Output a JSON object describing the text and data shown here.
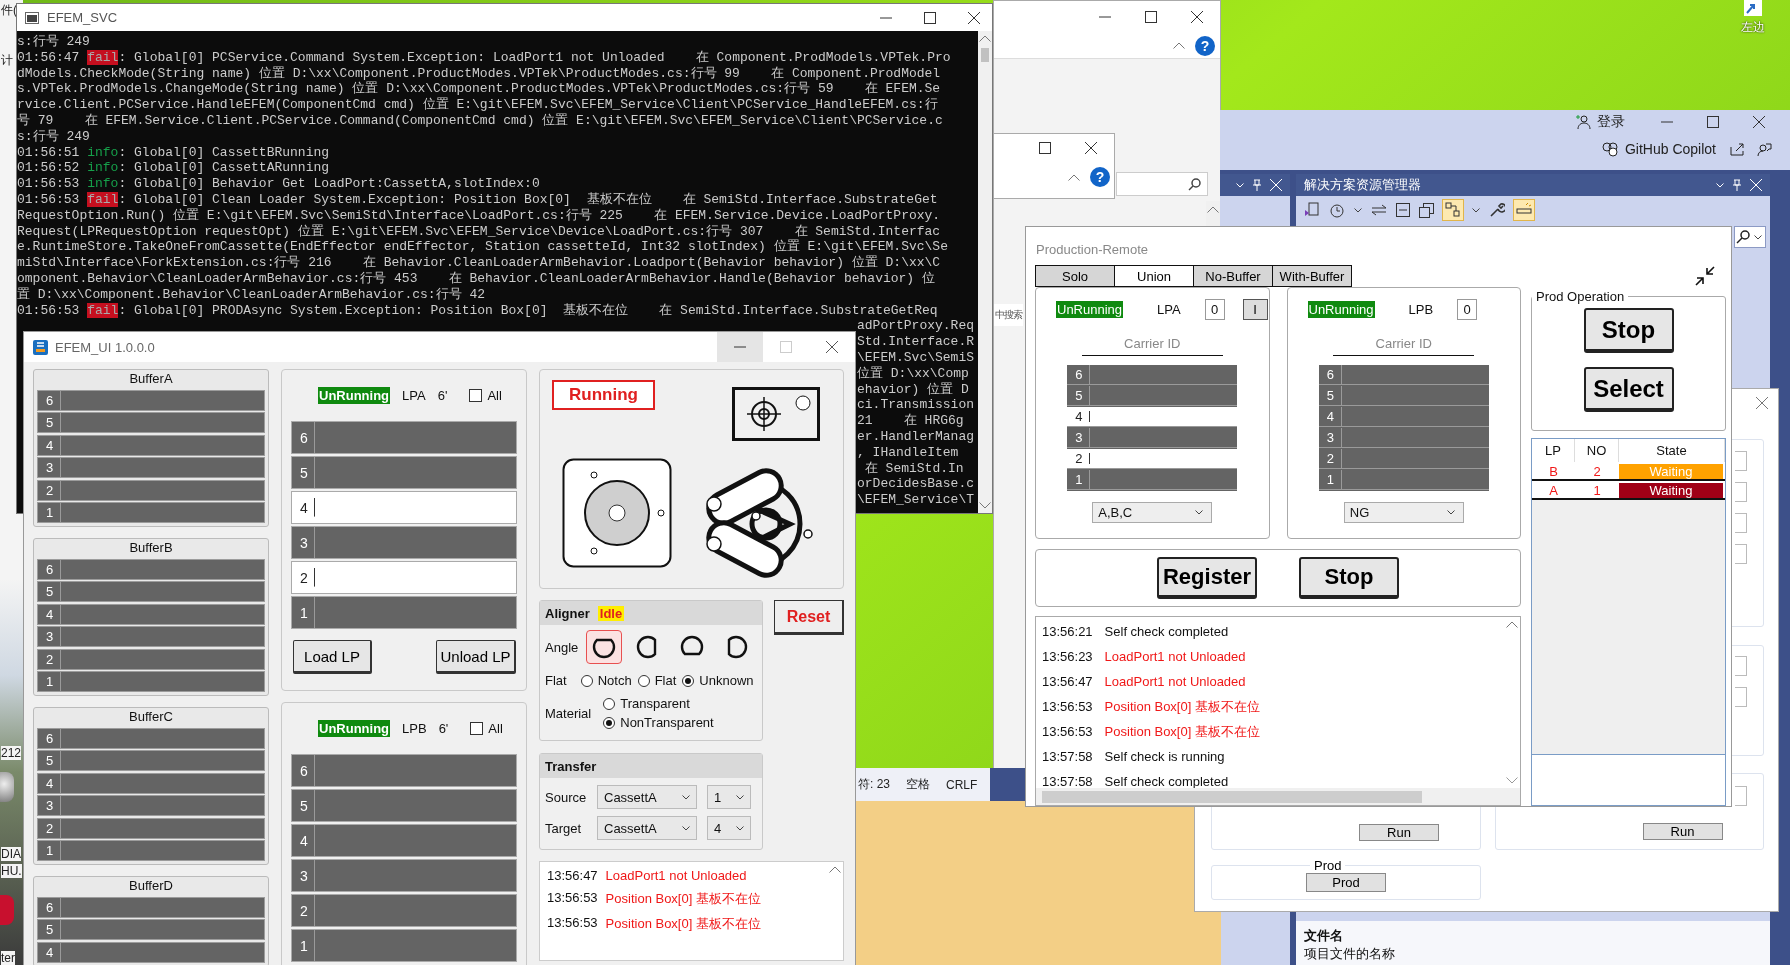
{
  "desktop": {
    "edge_labels": [
      "件(",
      "计",
      "212",
      "DIA",
      "HU.",
      "ter"
    ],
    "shortcut_label": "左边"
  },
  "explorer": {
    "help_marks": [
      "?",
      "?"
    ],
    "search_hint": "中搜索"
  },
  "ide": {
    "sign_in": "登录",
    "copilot": "GitHub Copilot",
    "panel_title": "解决方案资源管理器",
    "property_name": "文件名",
    "property_description": "项目文件的名称"
  },
  "editor_status": [
    "符: 23",
    "空格",
    "CRLF"
  ],
  "dialog": {
    "run_buttons": [
      "Run",
      "Run"
    ],
    "group_title": "Prod",
    "prod_button": "Prod"
  },
  "console": {
    "title": "EFEM_SVC",
    "lines": [
      {
        "kind": "plain",
        "text": "s:行号 249"
      },
      {
        "kind": "log",
        "time": "01:56:47",
        "level": "fail",
        "text": ": Global[0] PCService.Command System.Exception: LoadPort1 not Unloaded    在 Component.ProdModels.VPTek.Pro"
      },
      {
        "kind": "plain",
        "text": "dModels.CheckMode(String name) 位置 D:\\xx\\Component.ProductModes.VPTek\\ProductModes.cs:行号 99    在 Component.ProdModel"
      },
      {
        "kind": "plain",
        "text": "s.VPTek.ProdModels.ChangeMode(String name) 位置 D:\\xx\\Component.ProductModes.VPTek\\ProductModes.cs:行号 59    在 EFEM.Se"
      },
      {
        "kind": "plain",
        "text": "rvice.Client.PCService.HandleEFEM(ComponentCmd cmd) 位置 E:\\git\\EFEM.Svc\\EFEM_Service\\Client\\PCService_HandleEFEM.cs:行"
      },
      {
        "kind": "plain",
        "text": "号 79    在 EFEM.Service.Client.PCService.Command(ComponentCmd cmd) 位置 E:\\git\\EFEM.Svc\\EFEM_Service\\Client\\PCService.c"
      },
      {
        "kind": "plain",
        "text": "s:行号 249"
      },
      {
        "kind": "log",
        "time": "01:56:51",
        "level": "info",
        "text": ": Global[0] CassettBRunning"
      },
      {
        "kind": "log",
        "time": "01:56:52",
        "level": "info",
        "text": ": Global[0] CassettARunning"
      },
      {
        "kind": "log",
        "time": "01:56:53",
        "level": "info",
        "text": ": Global[0] Behavior Get LoadPort:CassettA,slotIndex:0"
      },
      {
        "kind": "log",
        "time": "01:56:53",
        "level": "fail",
        "text": ": Global[0] Clean Loader System.Exception: Position Box[0]  基板不在位    在 SemiStd.Interface.SubstrateGet"
      },
      {
        "kind": "plain",
        "text": "RequestOption.Run() 位置 E:\\git\\EFEM.Svc\\SemiStd\\Interface\\LoadPort.cs:行号 225    在 EFEM.Service.Device.LoadPortProxy."
      },
      {
        "kind": "plain",
        "text": "Request(LPRequestOption requestOpt) 位置 E:\\git\\EFEM.Svc\\EFEM_Service\\Device\\LoadPort.cs:行号 307    在 SemiStd.Interfac"
      },
      {
        "kind": "plain",
        "text": "e.RuntimeStore.TakeOneFromCassette(EndEffector endEffector, Station cassetteId, Int32 slotIndex) 位置 E:\\git\\EFEM.Svc\\Se"
      },
      {
        "kind": "plain",
        "text": "miStd\\Interface\\ForkExtension.cs:行号 216    在 Behavior.CleanLoaderArmBehavior.Loadport(Behavior behavior) 位置 D:\\xx\\C"
      },
      {
        "kind": "plain",
        "text": "omponent.Behavior\\CleanLoaderArmBehavior.cs:行号 453    在 Behavior.CleanLoaderArmBehavior.Handle(Behavior behavior) 位"
      },
      {
        "kind": "plain",
        "text": "置 D:\\xx\\Component.Behavior\\CleanLoaderArmBehavior.cs:行号 42"
      },
      {
        "kind": "log",
        "time": "01:56:53",
        "level": "fail",
        "text": ": Global[0] PRODAsync System.Exception: Position Box[0]  基板不在位    在 SemiStd.Interface.SubstrateGetReq"
      }
    ],
    "fragments": [
      "adPortProxy.Req",
      "Std.Interface.R",
      "\\EFEM.Svc\\SemiS",
      "位置 D:\\xx\\Comp",
      "ehavior) 位置 D",
      "ci.Transmission",
      "21    在 HRG6g",
      "er.HandlerManag",
      ", IHandleItem",
      " 在 SemiStd.In",
      "orDecidesBase.c",
      "\\EFEM_Service\\T"
    ]
  },
  "efem_ui": {
    "title": "EFEM_UI 1.0.0.0",
    "buffers": [
      {
        "name": "BufferA",
        "slots": [
          "6",
          "5",
          "4",
          "3",
          "2",
          "1"
        ]
      },
      {
        "name": "BufferB",
        "slots": [
          "6",
          "5",
          "4",
          "3",
          "2",
          "1"
        ]
      },
      {
        "name": "BufferC",
        "slots": [
          "6",
          "5",
          "4",
          "3",
          "2",
          "1"
        ]
      },
      {
        "name": "BufferD",
        "slots": [
          "6",
          "5",
          "4"
        ]
      }
    ],
    "load_ports": [
      {
        "status": "UnRunning",
        "port": "LPA",
        "size": "6'",
        "all_label": "All",
        "all_checked": false,
        "slots": [
          {
            "label": "6",
            "filled": false
          },
          {
            "label": "5",
            "filled": false
          },
          {
            "label": "4",
            "filled": true
          },
          {
            "label": "3",
            "filled": false
          },
          {
            "label": "2",
            "filled": true
          },
          {
            "label": "1",
            "filled": false
          }
        ],
        "buttons": [
          "Load LP",
          "Unload LP"
        ]
      },
      {
        "status": "UnRunning",
        "port": "LPB",
        "size": "6'",
        "all_label": "All",
        "all_checked": false,
        "slots": [
          {
            "label": "6",
            "filled": false
          },
          {
            "label": "5",
            "filled": false
          },
          {
            "label": "4",
            "filled": false
          },
          {
            "label": "3",
            "filled": false
          },
          {
            "label": "2",
            "filled": false
          },
          {
            "label": "1",
            "filled": false
          }
        ]
      }
    ],
    "robot_status": "Running",
    "aligner": {
      "title": "Aligner",
      "state": "Idle",
      "angle_label": "Angle",
      "angles": [
        {
          "selected": true
        },
        {
          "selected": false
        },
        {
          "selected": false
        },
        {
          "selected": false
        }
      ],
      "flat_label": "Flat",
      "flat_options": [
        {
          "label": "Notch",
          "selected": false
        },
        {
          "label": "Flat",
          "selected": false
        },
        {
          "label": "Unknown",
          "selected": true
        }
      ],
      "material_label": "Material",
      "material_options": [
        {
          "label": "Transparent",
          "selected": false
        },
        {
          "label": "NonTransparent",
          "selected": true
        }
      ]
    },
    "reset_button": "Reset",
    "transfer": {
      "title": "Transfer",
      "rows": [
        {
          "label": "Source",
          "station": "CassettA",
          "slot": "1"
        },
        {
          "label": "Target",
          "station": "CassettA",
          "slot": "4"
        }
      ]
    },
    "log": [
      {
        "time": "13:56:47",
        "message": "LoadPort1 not Unloaded",
        "kind": "error"
      },
      {
        "time": "13:56:53",
        "message": "Position Box[0] 基板不在位",
        "kind": "error"
      },
      {
        "time": "13:56:53",
        "message": "Position Box[0] 基板不在位",
        "kind": "error"
      }
    ]
  },
  "production_remote": {
    "title": "Production-Remote",
    "tabs": [
      {
        "label": "Solo",
        "selected": false
      },
      {
        "label": "Union",
        "selected": true
      },
      {
        "label": "No-Buffer",
        "selected": false
      },
      {
        "label": "With-Buffer",
        "selected": false
      }
    ],
    "ports": [
      {
        "status": "UnRunning",
        "port": "LPA",
        "count": "0",
        "extra_button": "I",
        "carrier_label": "Carrier ID",
        "slots": [
          {
            "label": "6",
            "filled": false
          },
          {
            "label": "5",
            "filled": false
          },
          {
            "label": "4",
            "filled": true
          },
          {
            "label": "3",
            "filled": false
          },
          {
            "label": "2",
            "filled": true
          },
          {
            "label": "1",
            "filled": false
          }
        ],
        "selection": "A,B,C"
      },
      {
        "status": "UnRunning",
        "port": "LPB",
        "count": "0",
        "carrier_label": "Carrier ID",
        "slots": [
          {
            "label": "6",
            "filled": false
          },
          {
            "label": "5",
            "filled": false
          },
          {
            "label": "4",
            "filled": false
          },
          {
            "label": "3",
            "filled": false
          },
          {
            "label": "2",
            "filled": false
          },
          {
            "label": "1",
            "filled": false
          }
        ],
        "selection": "NG"
      }
    ],
    "actions": [
      "Register",
      "Stop"
    ],
    "log": [
      {
        "time": "13:56:21",
        "message": "Self check completed",
        "kind": "info"
      },
      {
        "time": "13:56:23",
        "message": "LoadPort1 not Unloaded",
        "kind": "error"
      },
      {
        "time": "13:56:47",
        "message": "LoadPort1 not Unloaded",
        "kind": "error"
      },
      {
        "time": "13:56:53",
        "message": "Position Box[0] 基板不在位",
        "kind": "error"
      },
      {
        "time": "13:56:53",
        "message": "Position Box[0] 基板不在位",
        "kind": "error"
      },
      {
        "time": "13:57:58",
        "message": "Self check is running",
        "kind": "info"
      },
      {
        "time": "13:57:58",
        "message": "Self check completed",
        "kind": "info"
      }
    ],
    "operation": {
      "title": "Prod Operation",
      "buttons": [
        "Stop",
        "Select"
      ]
    },
    "queue": {
      "columns": [
        "LP",
        "NO",
        "State"
      ],
      "rows": [
        {
          "lp": "B",
          "no": "2",
          "state": "Waiting",
          "color": "#ffa200"
        },
        {
          "lp": "A",
          "no": "1",
          "state": "Waiting",
          "color": "#a00016"
        }
      ]
    }
  }
}
